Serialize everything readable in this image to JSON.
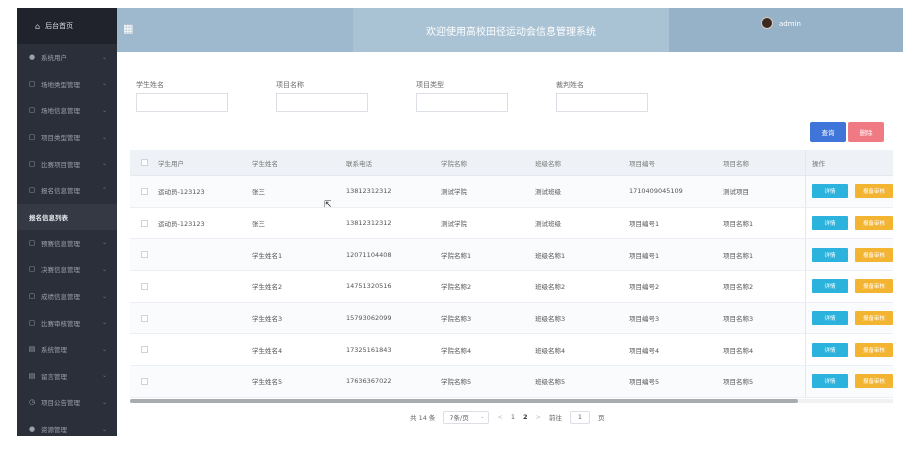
{
  "sidebar": {
    "header_label": "后台首页",
    "items": [
      {
        "label": "系统用户",
        "icon": "user-icon"
      },
      {
        "label": "场地类型管理",
        "icon": "folder-icon"
      },
      {
        "label": "场地信息管理",
        "icon": "folder-icon"
      },
      {
        "label": "项目类型管理",
        "icon": "folder-icon"
      },
      {
        "label": "比赛项目管理",
        "icon": "folder-icon"
      },
      {
        "label": "报名信息管理",
        "icon": "folder-icon",
        "expanded": true
      }
    ],
    "active_sub_item": "报名信息列表",
    "items_after": [
      {
        "label": "预赛信息管理",
        "icon": "folder-icon"
      },
      {
        "label": "决赛信息管理",
        "icon": "folder-icon"
      },
      {
        "label": "成绩信息管理",
        "icon": "folder-icon"
      },
      {
        "label": "比赛审核管理",
        "icon": "folder-icon"
      },
      {
        "label": "系统管理",
        "icon": "grid-icon"
      },
      {
        "label": "留言管理",
        "icon": "grid-icon"
      },
      {
        "label": "项目公告管理",
        "icon": "clock-icon"
      },
      {
        "label": "资源管理",
        "icon": "pin-icon"
      }
    ]
  },
  "topbar": {
    "title": "欢迎使用高校田径运动会信息管理系统",
    "username": "admin"
  },
  "search": {
    "fields": [
      {
        "label": "学生姓名",
        "value": ""
      },
      {
        "label": "项目名称",
        "value": ""
      },
      {
        "label": "项目类型",
        "value": ""
      },
      {
        "label": "裁判姓名",
        "value": ""
      }
    ],
    "query_label": "查询",
    "delete_label": "删除"
  },
  "table": {
    "headers": [
      "学生用户",
      "学生姓名",
      "联系电话",
      "学院名称",
      "班级名称",
      "项目编号",
      "项目名称",
      "操作"
    ],
    "rows": [
      [
        "运动员-123123",
        "张三",
        "13812312312",
        "测试学院",
        "测试班级",
        "1710409045109",
        "测试项目"
      ],
      [
        "运动员-123123",
        "张三",
        "13812312312",
        "测试学院",
        "测试班级",
        "项目编号1",
        "项目名称1"
      ],
      [
        "",
        "学生姓名1",
        "12071104408",
        "学院名称1",
        "班级名称1",
        "项目编号1",
        "项目名称1"
      ],
      [
        "",
        "学生姓名2",
        "14751320516",
        "学院名称2",
        "班级名称2",
        "项目编号2",
        "项目名称2"
      ],
      [
        "",
        "学生姓名3",
        "15793062099",
        "学院名称3",
        "班级名称3",
        "项目编号3",
        "项目名称3"
      ],
      [
        "",
        "学生姓名4",
        "17325161843",
        "学院名称4",
        "班级名称4",
        "项目编号4",
        "项目名称4"
      ],
      [
        "",
        "学生姓名5",
        "17636367022",
        "学院名称5",
        "班级名称5",
        "项目编号5",
        "项目名称5"
      ]
    ],
    "detail_label": "详情",
    "review_label": "报备审核"
  },
  "pagination": {
    "total_text": "共 14 条",
    "page_size": "7条/页",
    "prev": "<",
    "pages": [
      "1",
      "2"
    ],
    "current_page": "2",
    "next": ">",
    "goto_label": "前往",
    "goto_value": "1",
    "page_suffix": "页"
  },
  "colors": {
    "sidebar_bg": "#2b2f3a",
    "topbar_bg": "#9eb8cd",
    "query_btn": "#3f74d8",
    "delete_btn": "#f07a83",
    "detail_btn": "#2bb3de",
    "review_btn": "#f3b431"
  }
}
